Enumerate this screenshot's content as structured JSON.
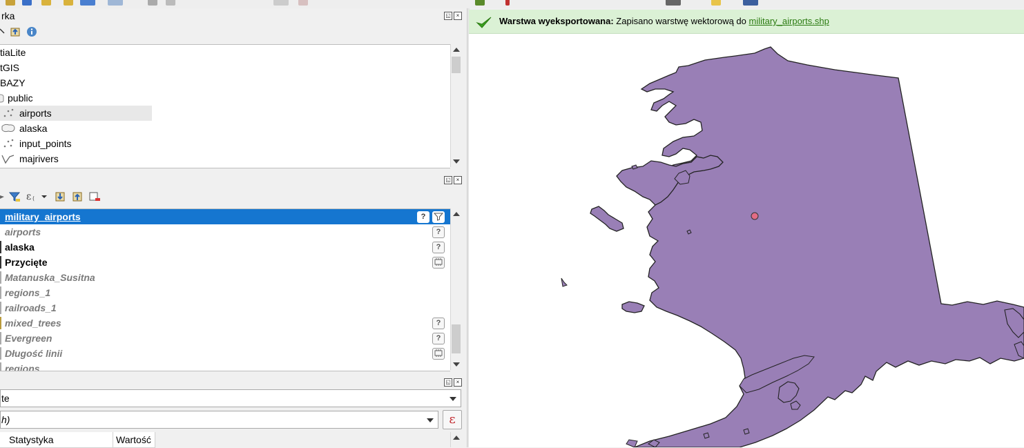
{
  "browser_panel": {
    "title_fragment": "rka",
    "tree_items": [
      {
        "label": "tiaLite",
        "icon": "none"
      },
      {
        "label": "tGIS",
        "icon": "none"
      },
      {
        "label": "BAZY",
        "icon": "none"
      },
      {
        "label": "public",
        "icon": "schema-icon"
      },
      {
        "label": "airports",
        "icon": "point-layer-icon",
        "selected": true
      },
      {
        "label": "alaska",
        "icon": "polygon-layer-icon"
      },
      {
        "label": "input_points",
        "icon": "point-layer-icon"
      },
      {
        "label": "majrivers",
        "icon": "line-layer-icon"
      }
    ]
  },
  "layers_panel": {
    "layers": [
      {
        "label": "military_airports",
        "style": "selected",
        "indicators": [
          "?",
          "filter"
        ]
      },
      {
        "label": "airports",
        "style": "gray",
        "indicators": [
          "?"
        ]
      },
      {
        "label": "alaska",
        "style": "normal",
        "indicators": [
          "?"
        ]
      },
      {
        "label": "Przycięte",
        "style": "normal",
        "indicators": [
          "memory"
        ]
      },
      {
        "label": "Matanuska_Susitna",
        "style": "gray",
        "indicators": []
      },
      {
        "label": "regions_1",
        "style": "gray",
        "indicators": []
      },
      {
        "label": "railroads_1",
        "style": "gray",
        "indicators": []
      },
      {
        "label": "mixed_trees",
        "style": "gray",
        "indicators": [
          "?"
        ]
      },
      {
        "label": "Evergreen",
        "style": "gray",
        "indicators": [
          "?"
        ]
      },
      {
        "label": "Długość linii",
        "style": "gray",
        "indicators": [
          "memory"
        ]
      },
      {
        "label": "regions",
        "style": "gray",
        "indicators": []
      }
    ]
  },
  "stats_panel": {
    "layer_combo_value": "te",
    "field_combo_value": "h)",
    "expression_button": "ε",
    "columns": [
      "Statystyka",
      "Wartość"
    ]
  },
  "message_bar": {
    "title": "Warstwa wyeksportowana:",
    "text": " Zapisano warstwę wektorową do ",
    "link": "military_airports.shp"
  },
  "colors": {
    "alaska_fill": "#997fb6",
    "point_fill": "#e26c85",
    "selection": "#1576d0",
    "message_bg": "#dbf1d5"
  }
}
